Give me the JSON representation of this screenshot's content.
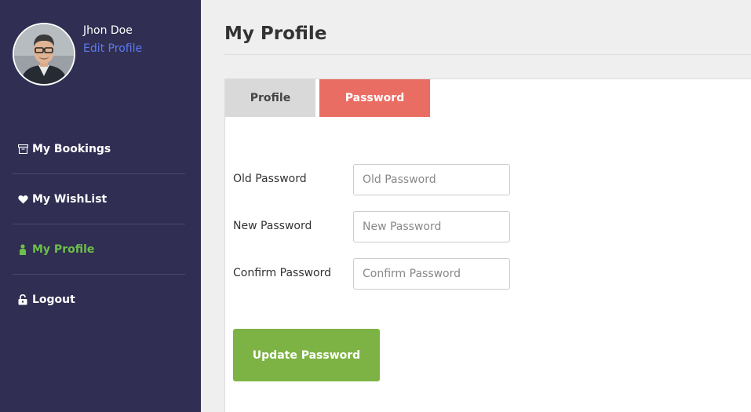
{
  "user": {
    "name": "Jhon Doe",
    "edit_label": "Edit Profile"
  },
  "sidebar": {
    "items": [
      {
        "label": "My Bookings",
        "icon": "archive-icon",
        "active": false
      },
      {
        "label": "My WishList",
        "icon": "heart-icon",
        "active": false
      },
      {
        "label": "My Profile",
        "icon": "person-icon",
        "active": true
      },
      {
        "label": "Logout",
        "icon": "lock-icon",
        "active": false
      }
    ]
  },
  "main": {
    "title": "My Profile",
    "tabs": [
      {
        "label": "Profile",
        "active": false
      },
      {
        "label": "Password",
        "active": true
      }
    ],
    "form": {
      "fields": [
        {
          "label": "Old Password",
          "placeholder": "Old Password",
          "value": ""
        },
        {
          "label": "New Password",
          "placeholder": "New Password",
          "value": ""
        },
        {
          "label": "Confirm Password",
          "placeholder": "Confirm Password",
          "value": ""
        }
      ],
      "submit_label": "Update Password"
    }
  },
  "colors": {
    "sidebar_bg": "#302e52",
    "active_nav": "#6cc04a",
    "link": "#5b7bf0",
    "active_tab": "#ea6d63",
    "inactive_tab": "#d9d9d9",
    "submit": "#7db344"
  }
}
